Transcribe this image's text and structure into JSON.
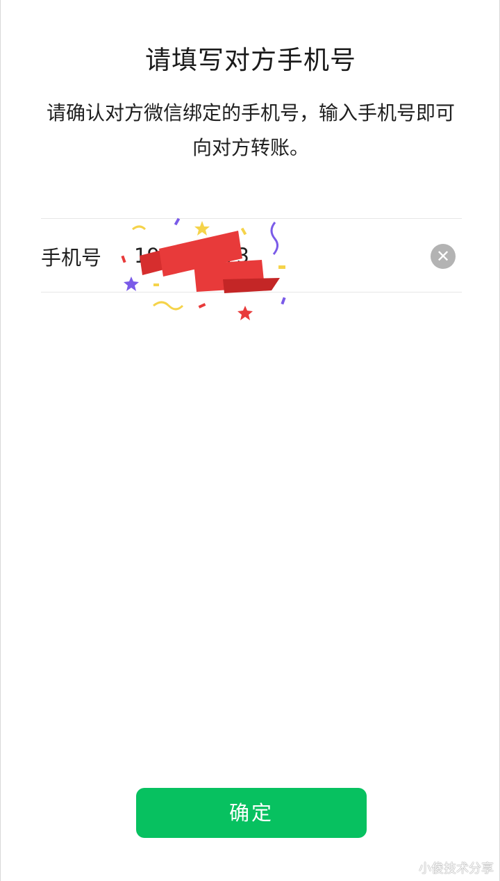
{
  "header": {
    "title": "请填写对方手机号",
    "description": "请确认对方微信绑定的手机号，输入手机号即可向对方转账。"
  },
  "form": {
    "phone_label": "手机号",
    "phone_value": "19        173",
    "clear_icon": "close-icon"
  },
  "footer": {
    "confirm_label": "确定"
  },
  "watermark": "小俊技术分享",
  "colors": {
    "accent": "#07c160",
    "sticker_red": "#e83a3a",
    "star_yellow": "#f5d34a",
    "star_purple": "#7a5be8"
  }
}
